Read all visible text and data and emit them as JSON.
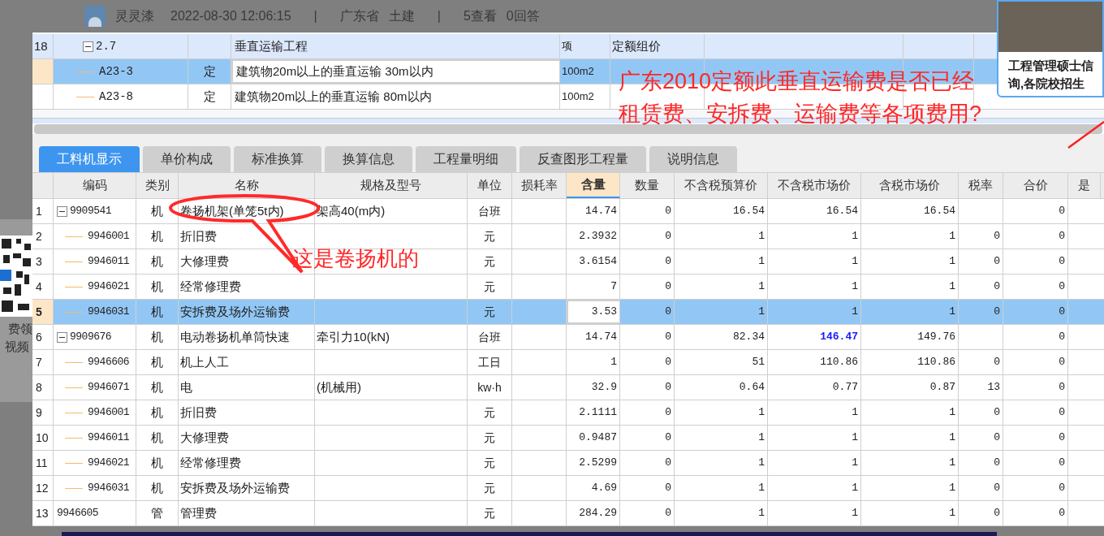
{
  "post_meta": [
    {
      "kind": "author",
      "text": "灵灵漆"
    },
    {
      "kind": "text",
      "text": "2022-08-30 12:06:15"
    },
    {
      "kind": "sep",
      "text": "|"
    },
    {
      "kind": "text",
      "text": "广东省"
    },
    {
      "kind": "text",
      "text": "土建"
    },
    {
      "kind": "sep",
      "text": "|"
    },
    {
      "kind": "text",
      "text": "5查看"
    },
    {
      "kind": "text",
      "text": "0回答"
    }
  ],
  "side_promo": {
    "lines": [
      "费领",
      "视频"
    ]
  },
  "ad_card": {
    "lines": [
      "工程管理硕士信",
      "询,各院校招生"
    ]
  },
  "question_overlay": {
    "lines": [
      "广东2010定额此垂直运输费是否已经",
      "租赁费、安拆费、运输费等各项费用?"
    ]
  },
  "top_table": {
    "rows": [
      {
        "num": "18",
        "code": "2.7",
        "name": "垂直运输工程",
        "unit": "项",
        "pricing": "定额组价",
        "expanded": true,
        "selected": false,
        "children": [
          {
            "code": "A23-3",
            "type": "定",
            "name": "建筑物20m以上的垂直运输 30m以内",
            "unit": "100m2",
            "selected": true
          },
          {
            "code": "A23-8",
            "type": "定",
            "name": "建筑物20m以上的垂直运输 80m以内",
            "unit": "100m2",
            "selected": false
          }
        ]
      }
    ]
  },
  "tabs": [
    {
      "label": "工料机显示",
      "selected": true
    },
    {
      "label": "单价构成",
      "selected": false
    },
    {
      "label": "标准换算",
      "selected": false
    },
    {
      "label": "换算信息",
      "selected": false
    },
    {
      "label": "工程量明细",
      "selected": false
    },
    {
      "label": "反查图形工程量",
      "selected": false
    },
    {
      "label": "说明信息",
      "selected": false
    }
  ],
  "grid": {
    "columns": [
      {
        "label": "编码",
        "selected": false
      },
      {
        "label": "类别",
        "selected": false
      },
      {
        "label": "名称",
        "selected": false
      },
      {
        "label": "规格及型号",
        "selected": false
      },
      {
        "label": "单位",
        "selected": false
      },
      {
        "label": "损耗率",
        "selected": false
      },
      {
        "label": "含量",
        "selected": true
      },
      {
        "label": "数量",
        "selected": false
      },
      {
        "label": "不含税预算价",
        "selected": false
      },
      {
        "label": "不含税市场价",
        "selected": false
      },
      {
        "label": "含税市场价",
        "selected": false
      },
      {
        "label": "税率",
        "selected": false
      },
      {
        "label": "合价",
        "selected": false
      },
      {
        "label": "是",
        "selected": false
      }
    ],
    "rows": [
      {
        "num": "1",
        "code": "9909541",
        "type": "机",
        "name": "卷扬机架(单笼5t内)",
        "spec": "架高40(m内)",
        "unit": "台班",
        "qty": "14.74",
        "count": "0",
        "budget_price": "16.54",
        "market_price": "16.54",
        "tax_market_price": "16.54",
        "total": "0",
        "expanded": true,
        "selected": false,
        "market_price_edited": false,
        "children": [
          {
            "num": "2",
            "code": "9946001",
            "type": "机",
            "name": "折旧费",
            "unit": "元",
            "qty": "2.3932",
            "count": "0",
            "budget_price": "1",
            "market_price": "1",
            "tax_market_price": "1",
            "tax_rate": "0",
            "total": "0",
            "selected": false,
            "market_price_edited": false
          },
          {
            "num": "3",
            "code": "9946011",
            "type": "机",
            "name": "大修理费",
            "unit": "元",
            "qty": "3.6154",
            "count": "0",
            "budget_price": "1",
            "market_price": "1",
            "tax_market_price": "1",
            "tax_rate": "0",
            "total": "0",
            "selected": false,
            "market_price_edited": false
          },
          {
            "num": "4",
            "code": "9946021",
            "type": "机",
            "name": "经常修理费",
            "unit": "元",
            "qty": "7",
            "count": "0",
            "budget_price": "1",
            "market_price": "1",
            "tax_market_price": "1",
            "tax_rate": "0",
            "total": "0",
            "selected": false,
            "market_price_edited": false
          },
          {
            "num": "5",
            "code": "9946031",
            "type": "机",
            "name": "安拆费及场外运输费",
            "unit": "元",
            "qty": "3.53",
            "count": "0",
            "budget_price": "1",
            "market_price": "1",
            "tax_market_price": "1",
            "tax_rate": "0",
            "total": "0",
            "selected": true,
            "market_price_edited": false
          }
        ]
      },
      {
        "num": "6",
        "code": "9909676",
        "type": "机",
        "name": "电动卷扬机单筒快速",
        "spec": "牵引力10(kN)",
        "unit": "台班",
        "qty": "14.74",
        "count": "0",
        "budget_price": "82.34",
        "market_price": "146.47",
        "tax_market_price": "149.76",
        "total": "0",
        "expanded": true,
        "selected": false,
        "market_price_edited": true,
        "children": [
          {
            "num": "7",
            "code": "9946606",
            "type": "机",
            "name": "机上人工",
            "unit": "工日",
            "qty": "1",
            "count": "0",
            "budget_price": "51",
            "market_price": "110.86",
            "tax_market_price": "110.86",
            "tax_rate": "0",
            "total": "0",
            "selected": false,
            "market_price_edited": false
          },
          {
            "num": "8",
            "code": "9946071",
            "type": "机",
            "name": "电",
            "spec": "(机械用)",
            "unit": "kw·h",
            "qty": "32.9",
            "count": "0",
            "budget_price": "0.64",
            "market_price": "0.77",
            "tax_market_price": "0.87",
            "tax_rate": "13",
            "total": "0",
            "selected": false,
            "market_price_edited": false
          },
          {
            "num": "9",
            "code": "9946001",
            "type": "机",
            "name": "折旧费",
            "unit": "元",
            "qty": "2.1111",
            "count": "0",
            "budget_price": "1",
            "market_price": "1",
            "tax_market_price": "1",
            "tax_rate": "0",
            "total": "0",
            "selected": false,
            "market_price_edited": false
          },
          {
            "num": "10",
            "code": "9946011",
            "type": "机",
            "name": "大修理费",
            "unit": "元",
            "qty": "0.9487",
            "count": "0",
            "budget_price": "1",
            "market_price": "1",
            "tax_market_price": "1",
            "tax_rate": "0",
            "total": "0",
            "selected": false,
            "market_price_edited": false
          },
          {
            "num": "11",
            "code": "9946021",
            "type": "机",
            "name": "经常修理费",
            "unit": "元",
            "qty": "2.5299",
            "count": "0",
            "budget_price": "1",
            "market_price": "1",
            "tax_market_price": "1",
            "tax_rate": "0",
            "total": "0",
            "selected": false,
            "market_price_edited": false
          },
          {
            "num": "12",
            "code": "9946031",
            "type": "机",
            "name": "安拆费及场外运输费",
            "unit": "元",
            "qty": "4.69",
            "count": "0",
            "budget_price": "1",
            "market_price": "1",
            "tax_market_price": "1",
            "tax_rate": "0",
            "total": "0",
            "selected": false,
            "market_price_edited": false
          }
        ]
      },
      {
        "num": "13",
        "code": "9946605",
        "type": "管",
        "name": "管理费",
        "unit": "元",
        "qty": "284.29",
        "count": "0",
        "budget_price": "1",
        "market_price": "1",
        "tax_market_price": "1",
        "tax_rate": "0",
        "total": "0",
        "selected": false,
        "market_price_edited": false
      }
    ]
  },
  "annotation": {
    "text": "这是卷扬机的"
  }
}
